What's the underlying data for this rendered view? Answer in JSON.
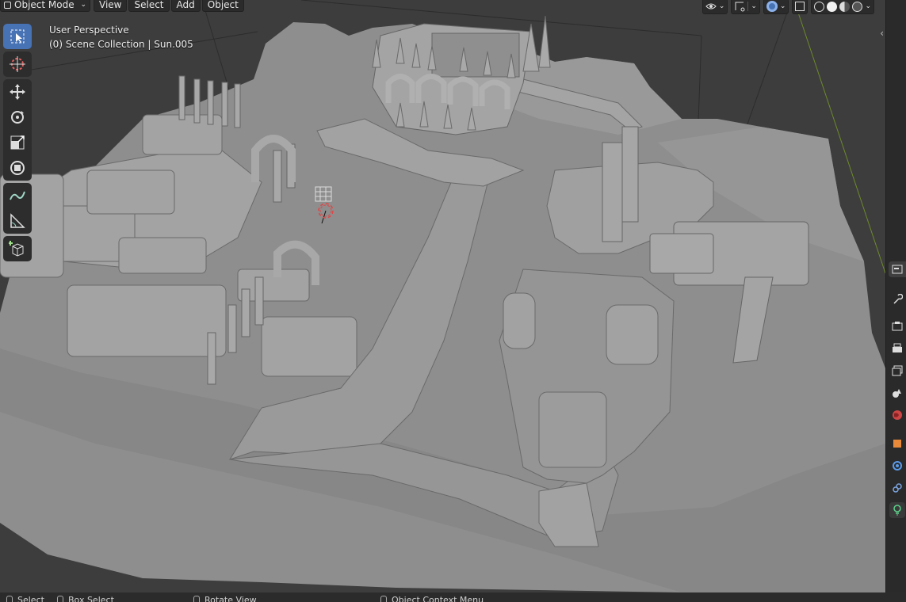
{
  "header": {
    "mode_label": "Object Mode",
    "menus": [
      "View",
      "Select",
      "Add",
      "Object"
    ]
  },
  "overlay": {
    "perspective": "User Perspective",
    "collection": "(0) Scene Collection | Sun.005"
  },
  "toolbar": {
    "tools": [
      "select-box",
      "cursor",
      "move",
      "rotate",
      "scale",
      "transform",
      "annotate",
      "measure",
      "add-cube"
    ],
    "active_tool": "select-box"
  },
  "properties_tabs": [
    "tool",
    "render",
    "output",
    "view-layer",
    "scene",
    "world",
    "object",
    "modifiers",
    "physics",
    "object-data"
  ],
  "statusbar": {
    "select": "Select",
    "box_select": "Box Select",
    "rotate_view": "Rotate View",
    "context_menu": "Object Context Menu"
  },
  "colors": {
    "viewport_bg": "#3d3d3d",
    "active_tool": "#4772b3",
    "panel": "#2b2b2b",
    "mesh": "#9b9b9b"
  }
}
